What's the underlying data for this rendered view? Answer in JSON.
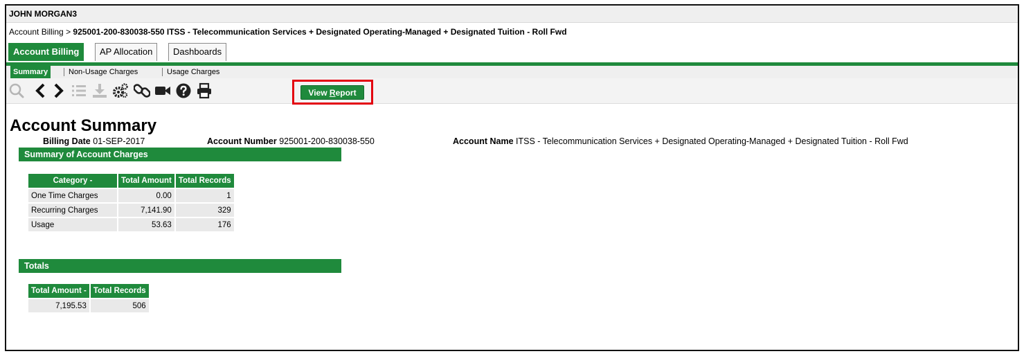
{
  "app": {
    "user": "JOHN MORGAN3"
  },
  "breadcrumb": {
    "parent": "Account Billing",
    "separator": ">",
    "current": "925001-200-830038-550 ITSS - Telecommunication Services + Designated Operating-Managed + Designated Tuition - Roll Fwd"
  },
  "tabs": [
    {
      "label": "Account Billing",
      "active": true
    },
    {
      "label": "AP Allocation",
      "active": false
    },
    {
      "label": "Dashboards",
      "active": false
    }
  ],
  "subtabs": [
    {
      "label": "Summary",
      "active": true
    },
    {
      "label": "Non-Usage Charges",
      "active": false
    },
    {
      "label": "Usage Charges",
      "active": false
    }
  ],
  "toolbar": {
    "icons": [
      "search-icon",
      "chevron-left-icon",
      "chevron-right-icon",
      "list-icon",
      "download-icon",
      "settings-icon",
      "link-icon",
      "video-icon",
      "help-icon",
      "print-icon"
    ],
    "view_report_prefix": "View ",
    "view_report_underlined": "R",
    "view_report_suffix": "eport"
  },
  "summary": {
    "title": "Account Summary",
    "billing_date_label": "Billing Date",
    "billing_date": "01-SEP-2017",
    "account_number_label": "Account Number",
    "account_number": "925001-200-830038-550",
    "account_name_label": "Account Name",
    "account_name": "ITSS - Telecommunication Services + Designated Operating-Managed + Designated Tuition - Roll Fwd"
  },
  "charges": {
    "section_title": "Summary of Account Charges",
    "headers": [
      "Category -",
      "Total Amount",
      "Total Records"
    ],
    "rows": [
      [
        "One Time Charges",
        "0.00",
        "1"
      ],
      [
        "Recurring Charges",
        "7,141.90",
        "329"
      ],
      [
        "Usage",
        "53.63",
        "176"
      ]
    ]
  },
  "totals": {
    "section_title": "Totals",
    "headers": [
      "Total Amount -",
      "Total Records"
    ],
    "rows": [
      [
        "7,195.53",
        "506"
      ]
    ]
  },
  "colors": {
    "brand_green": "#1f8a3c",
    "highlight_red": "#e3000f"
  }
}
